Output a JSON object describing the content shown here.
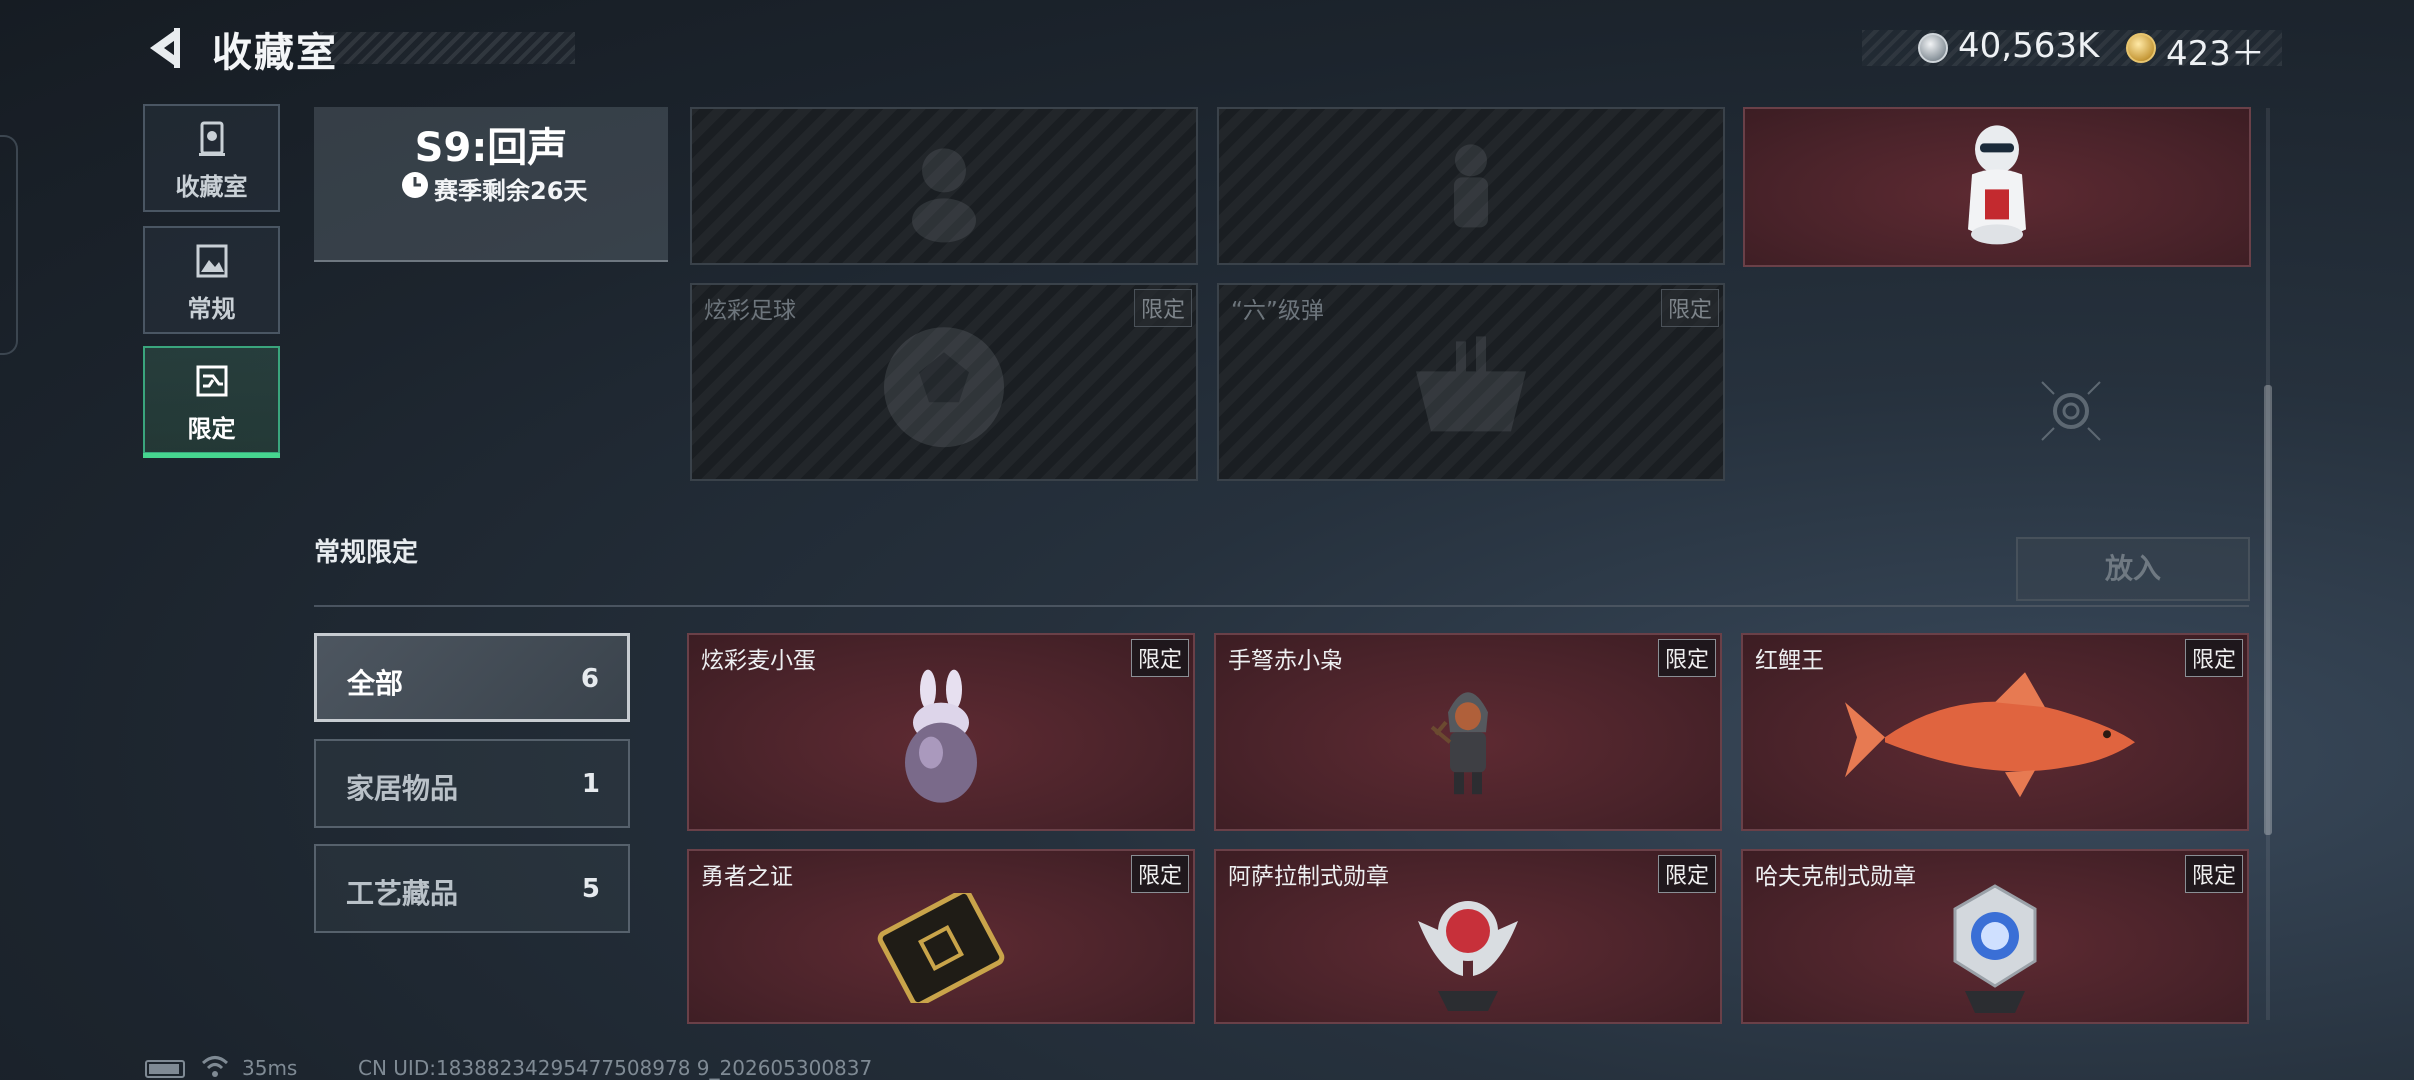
{
  "header": {
    "title": "收藏室",
    "currency_silver": "40,563K",
    "currency_gold": "423＋"
  },
  "nav": {
    "tabs": [
      {
        "label": "收藏室",
        "icon": "trophy-icon"
      },
      {
        "label": "常规",
        "icon": "picture-icon"
      },
      {
        "label": "限定",
        "icon": "shuffle-icon",
        "active": true
      }
    ]
  },
  "season": {
    "title": "S9:回声",
    "remaining": "赛季剩余26天"
  },
  "top_grid": {
    "tiles": [
      {
        "name": "",
        "badge": "",
        "owned": false
      },
      {
        "name": "",
        "badge": "",
        "owned": false
      },
      {
        "name": "",
        "badge": "",
        "owned": true,
        "art": "colonel-figure"
      },
      {
        "name": "炫彩足球",
        "badge": "限定",
        "owned": false
      },
      {
        "name": "“六”级弹",
        "badge": "限定",
        "owned": false
      }
    ]
  },
  "section": {
    "title": "常规限定",
    "put_button": "放入"
  },
  "filters": [
    {
      "label": "全部",
      "count": "6",
      "active": true
    },
    {
      "label": "家居物品",
      "count": "1"
    },
    {
      "label": "工艺藏品",
      "count": "5"
    }
  ],
  "items": [
    {
      "name": "炫彩麦小蛋",
      "badge": "限定",
      "art": "bunny-egg"
    },
    {
      "name": "手弩赤小枭",
      "badge": "限定",
      "art": "hooded-figure"
    },
    {
      "name": "红鲤王",
      "badge": "限定",
      "art": "red-carp"
    },
    {
      "name": "勇者之证",
      "badge": "限定",
      "art": "gold-card"
    },
    {
      "name": "阿萨拉制式勋章",
      "badge": "限定",
      "art": "red-medal"
    },
    {
      "name": "哈夫克制式勋章",
      "badge": "限定",
      "art": "blue-medal"
    }
  ],
  "status_bar": {
    "ping": "35ms",
    "uid": "CN UID:18388234295477508978 9_202605300837"
  },
  "colors": {
    "accent": "#46d58f",
    "tile_red": "#4a232a",
    "background": "#1c242d"
  }
}
